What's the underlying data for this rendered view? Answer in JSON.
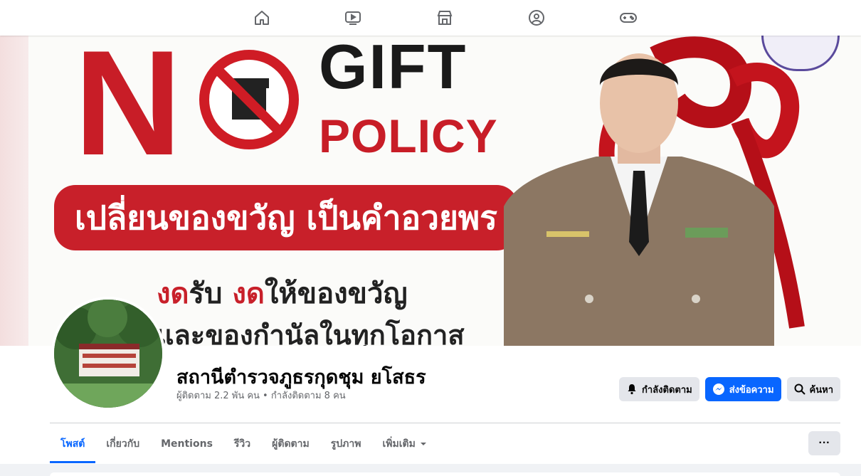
{
  "topnav": {
    "icons": [
      "home-icon",
      "watch-icon",
      "marketplace-icon",
      "groups-icon",
      "gaming-icon"
    ]
  },
  "cover": {
    "no": "N",
    "gift": "GIFT",
    "policy": "POLICY",
    "banner": "เปลี่ยนของขวัญ เป็นคำอวยพร",
    "line1_red_a": "งด",
    "line1_mid": "รับ ",
    "line1_red_b": "งด",
    "line1_end": "ให้ของขวัญ",
    "line2": "และของกำนัลในทุกโอกาส"
  },
  "profile": {
    "name": "สถานีตำรวจภูธรกุดชุม ยโสธร",
    "stats": "ผู้ติดตาม 2.2 พัน คน • กำลังติดตาม 8 คน"
  },
  "actions": {
    "following": "กำลังติดตาม",
    "message": "ส่งข้อความ",
    "search": "ค้นหา"
  },
  "tabs": [
    {
      "label": "โพสต์",
      "active": true
    },
    {
      "label": "เกี่ยวกับ",
      "active": false
    },
    {
      "label": "Mentions",
      "active": false
    },
    {
      "label": "รีวิว",
      "active": false
    },
    {
      "label": "ผู้ติดตาม",
      "active": false
    },
    {
      "label": "รูปภาพ",
      "active": false
    },
    {
      "label": "เพิ่มเติม",
      "active": false
    }
  ],
  "more_button": "···",
  "colors": {
    "accent": "#0866ff",
    "red": "#c8202a",
    "text_secondary": "#65676b"
  }
}
